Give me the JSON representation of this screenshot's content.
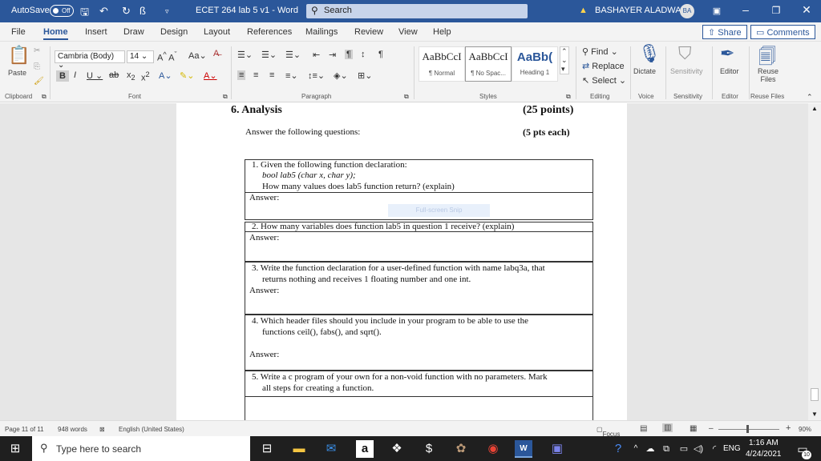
{
  "titlebar": {
    "autosave": "AutoSave",
    "autosave_state": "Off",
    "doc_title": "ECET 264 lab 5 v1",
    "app_sep": "-",
    "app_name": "Word",
    "search": "Search",
    "user": "BASHAYER ALADWANI",
    "initials": "BA"
  },
  "menu": {
    "tabs": [
      "File",
      "Home",
      "Insert",
      "Draw",
      "Design",
      "Layout",
      "References",
      "Mailings",
      "Review",
      "View",
      "Help"
    ],
    "share": "Share",
    "comments": "Comments"
  },
  "ribbon": {
    "paste": "Paste",
    "font_name": "Cambria (Body)",
    "font_size": "14",
    "styles": [
      {
        "preview": "AaBbCcI",
        "name": "¶ Normal"
      },
      {
        "preview": "AaBbCcI",
        "name": "¶ No Spac..."
      },
      {
        "preview": "AaBb(",
        "name": "Heading 1"
      }
    ],
    "find": "Find",
    "replace": "Replace",
    "select": "Select",
    "dictate": "Dictate",
    "sensitivity": "Sensitivity",
    "editor": "Editor",
    "reuse_files": "Reuse Files",
    "groups": [
      "Clipboard",
      "Font",
      "Paragraph",
      "Styles",
      "Editing",
      "Voice",
      "Sensitivity",
      "Editor",
      "Reuse Files"
    ]
  },
  "doc": {
    "heading": "6.   Analysis",
    "points": "(25 points)",
    "instructions": "Answer the following questions:",
    "each": "(5 pts each)",
    "q1_line1": "1.  Given the following function declaration:",
    "q1_line2": "bool lab5 (char x,  char y);",
    "q1_line3": "How many values does lab5 function return? (explain)",
    "answer": "Answer:",
    "snip": "Full-screen Snip",
    "q2": "2.  How many variables does function lab5 in question 1 receive? (explain)",
    "q3_line1": "3.  Write the function declaration for a user-defined function with name labq3a, that",
    "q3_line2": "returns nothing  and receives 1 floating number and one int.",
    "q4_line1": "4.  Which header files should you include in your program to be able to use the",
    "q4_line2": "functions ceil(), fabs(), and sqrt().",
    "q5_line1": "5.  Write a c program of your own for a non-void function with no parameters. Mark",
    "q5_line2": "all steps for creating a function."
  },
  "status": {
    "page": "Page 11 of 11",
    "words": "948 words",
    "language": "English (United States)",
    "focus": "Focus",
    "zoom": "90%"
  },
  "taskbar": {
    "search": "Type here to search",
    "lang": "ENG",
    "time": "1:16 AM",
    "date": "4/24/2021",
    "notifications": "10"
  }
}
